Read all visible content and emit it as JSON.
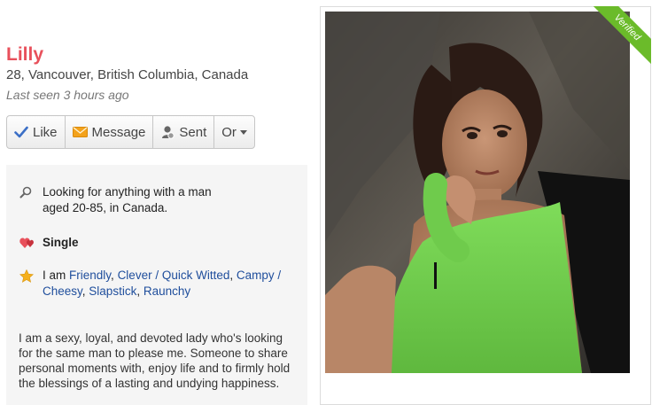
{
  "profile": {
    "name": "Lilly",
    "location": "28, Vancouver, British Columbia, Canada",
    "last_seen": "Last seen 3 hours ago"
  },
  "actions": {
    "like": "Like",
    "message": "Message",
    "sent": "Sent",
    "more": "Or"
  },
  "info": {
    "looking_for_line1": "Looking for anything with a man",
    "looking_for_line2": "aged 20-85, in Canada.",
    "status": "Single",
    "traits_prefix": "I am",
    "traits": [
      "Friendly",
      "Clever / Quick Witted",
      "Campy / Cheesy",
      "Slapstick",
      "Raunchy"
    ],
    "bio": "I am a sexy, loyal, and devoted lady who's looking for the same man to please me. Someone to share personal moments with, enjoy life and to firmly hold the blessings of a lasting and undying happiness."
  },
  "photo": {
    "badge": "Verified"
  },
  "colors": {
    "name": "#e8505b",
    "link": "#1f4e9c",
    "ribbon": "#6bbb2a",
    "panel_bg": "#f5f5f5"
  },
  "icons": {
    "like": "checkmark-icon",
    "message": "envelope-icon",
    "sent": "person-icon",
    "more": "caret-down-icon",
    "looking_for": "search-icon",
    "status": "hearts-icon",
    "traits": "star-icon"
  }
}
